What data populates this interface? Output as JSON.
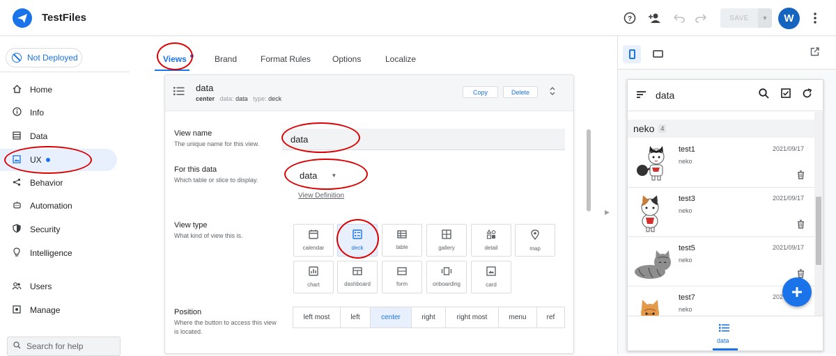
{
  "app": {
    "title": "TestFiles",
    "avatar_letter": "W",
    "save_label": "SAVE"
  },
  "icons": {
    "logo": "paper-plane-icon",
    "help": "help-icon",
    "share": "person-add-icon",
    "undo": "undo-icon",
    "redo": "redo-icon",
    "more": "more-vert-icon"
  },
  "sidebar": {
    "deploy_status": "Not Deployed",
    "items": [
      {
        "label": "Home",
        "icon": "home-icon"
      },
      {
        "label": "Info",
        "icon": "info-icon"
      },
      {
        "label": "Data",
        "icon": "database-icon"
      },
      {
        "label": "UX",
        "icon": "image-icon",
        "active": true
      },
      {
        "label": "Behavior",
        "icon": "share-icon"
      },
      {
        "label": "Automation",
        "icon": "robot-icon"
      },
      {
        "label": "Security",
        "icon": "shield-icon"
      },
      {
        "label": "Intelligence",
        "icon": "bulb-icon"
      },
      {
        "label": "Users",
        "icon": "users-icon"
      },
      {
        "label": "Manage",
        "icon": "gear-icon"
      }
    ],
    "search_placeholder": "Search for help"
  },
  "tabs": [
    "Views",
    "Brand",
    "Format Rules",
    "Options",
    "Localize"
  ],
  "view": {
    "title": "data",
    "sub_position": "center",
    "sub_data_label": "data:",
    "sub_data": "data",
    "sub_type_label": "type:",
    "sub_type": "deck",
    "copy_label": "Copy",
    "delete_label": "Delete",
    "name_label": "View name",
    "name_desc": "The unique name for this view.",
    "name_value": "data",
    "for_label": "For this data",
    "for_desc": "Which table or slice to display.",
    "for_value": "data",
    "view_definition": "View Definition",
    "type_label": "View type",
    "type_desc": "What kind of view this is.",
    "types": [
      "calendar",
      "deck",
      "table",
      "gallery",
      "detail",
      "map",
      "chart",
      "dashboard",
      "form",
      "onboarding",
      "card"
    ],
    "selected_type": "deck",
    "position_label": "Position",
    "position_desc": "Where the button to access this view is located.",
    "positions": [
      "left most",
      "left",
      "center",
      "right",
      "right most",
      "menu",
      "ref"
    ],
    "selected_position": "center"
  },
  "preview": {
    "title": "data",
    "group": "neko",
    "group_count": "4",
    "rows": [
      {
        "title": "test1",
        "sub": "neko",
        "date": "2021/09/17"
      },
      {
        "title": "test3",
        "sub": "neko",
        "date": "2021/09/17"
      },
      {
        "title": "test5",
        "sub": "neko",
        "date": "2021/09/17"
      },
      {
        "title": "test7",
        "sub": "neko",
        "date": "202"
      }
    ],
    "bottom_label": "data"
  }
}
